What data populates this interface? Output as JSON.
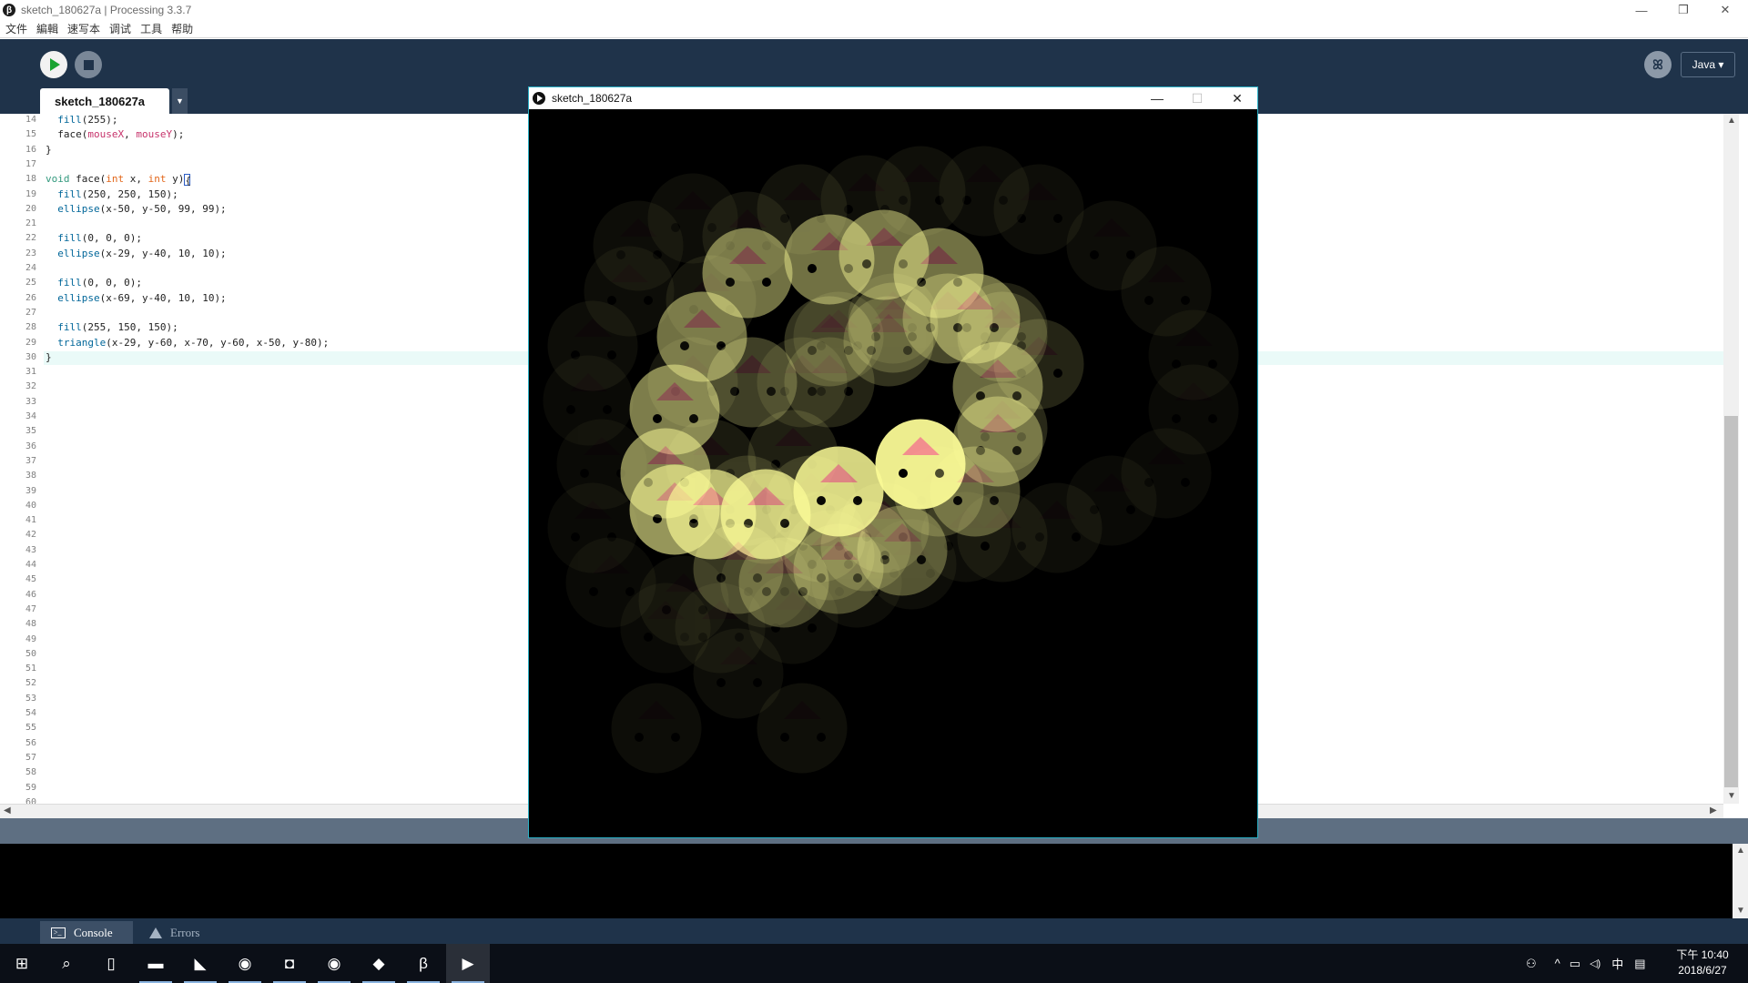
{
  "window": {
    "title": "sketch_180627a | Processing 3.3.7",
    "app_icon_glyph": "β"
  },
  "menu": [
    "文件",
    "編輯",
    "速写本",
    "调试",
    "工具",
    "帮助"
  ],
  "toolbar": {
    "run_icon": "play-icon",
    "stop_icon": "stop-icon",
    "debug_glyph": "ꕤ",
    "mode": "Java ▾"
  },
  "tab": {
    "name": "sketch_180627a",
    "menu_glyph": "▼"
  },
  "editor": {
    "current_line": 30,
    "lines": [
      {
        "n": 14,
        "html": "  <span class='fn'>fill</span>(255);"
      },
      {
        "n": 15,
        "html": "  face(<span class='var'>mouseX</span>, <span class='var'>mouseY</span>);"
      },
      {
        "n": 16,
        "html": "}"
      },
      {
        "n": 17,
        "html": ""
      },
      {
        "n": 18,
        "html": "<span class='kw'>void</span> face(<span class='type'>int</span> x, <span class='type'>int</span> y)<span id='caret'>{</span>"
      },
      {
        "n": 19,
        "html": "  <span class='fn'>fill</span>(250, 250, 150);"
      },
      {
        "n": 20,
        "html": "  <span class='fn'>ellipse</span>(x-50, y-50, 99, 99);"
      },
      {
        "n": 21,
        "html": ""
      },
      {
        "n": 22,
        "html": "  <span class='fn'>fill</span>(0, 0, 0);"
      },
      {
        "n": 23,
        "html": "  <span class='fn'>ellipse</span>(x-29, y-40, 10, 10);"
      },
      {
        "n": 24,
        "html": ""
      },
      {
        "n": 25,
        "html": "  <span class='fn'>fill</span>(0, 0, 0);"
      },
      {
        "n": 26,
        "html": "  <span class='fn'>ellipse</span>(x-69, y-40, 10, 10);"
      },
      {
        "n": 27,
        "html": ""
      },
      {
        "n": 28,
        "html": "  <span class='fn'>fill</span>(255, 150, 150);"
      },
      {
        "n": 29,
        "html": "  <span class='fn'>triangle</span>(x-29, y-60, x-70, y-60, x-50, y-80);"
      },
      {
        "n": 30,
        "html": "}"
      }
    ],
    "empty_line_numbers": [
      31,
      32,
      33,
      34,
      35,
      36,
      37,
      38,
      39,
      40,
      41,
      42,
      43,
      44,
      45,
      46,
      47,
      48,
      49,
      50,
      51,
      52,
      53,
      54,
      55,
      56,
      57,
      58,
      59,
      60
    ]
  },
  "sketch_window": {
    "title": "sketch_180627a",
    "minimize": "—",
    "maximize": "☐",
    "close": "✕"
  },
  "console": {
    "tabs": [
      {
        "label": "Console",
        "active": true
      },
      {
        "label": "Errors",
        "active": false
      }
    ]
  },
  "taskbar": {
    "apps": [
      {
        "name": "start-icon",
        "glyph": "⊞"
      },
      {
        "name": "search-icon",
        "glyph": "⌕"
      },
      {
        "name": "task-view-icon",
        "glyph": "▯"
      },
      {
        "name": "file-explorer-icon",
        "glyph": "▬"
      },
      {
        "name": "visual-studio-icon",
        "glyph": "◣"
      },
      {
        "name": "chrome-icon",
        "glyph": "◉"
      },
      {
        "name": "discord-icon",
        "glyph": "◘"
      },
      {
        "name": "chrome-2-icon",
        "glyph": "◉"
      },
      {
        "name": "notepad-icon",
        "glyph": "◆"
      },
      {
        "name": "processing-icon",
        "glyph": "β"
      },
      {
        "name": "sketch-window-icon",
        "glyph": "▶"
      }
    ],
    "tray": {
      "people": "⚇",
      "chevron": "^",
      "network": "▭",
      "volume": "◁)",
      "ime": "中",
      "notify": "▤"
    },
    "clock_time": "下午 10:40",
    "clock_date": "2018/6/27"
  },
  "colors": {
    "toolbar": "#1f334a",
    "face_fill": "#fafa96",
    "eye_fill": "#000000",
    "nose_fill": "#ff9696",
    "accent": "#2ab0c6"
  }
}
